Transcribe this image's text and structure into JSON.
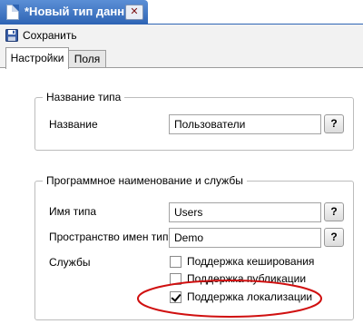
{
  "document_tab": {
    "title": "*Новый тип данны",
    "close_glyph": "✕"
  },
  "toolbar": {
    "save_label": "Сохранить"
  },
  "tabs": [
    {
      "label": "Настройки",
      "active": true
    },
    {
      "label": "Поля",
      "active": false
    }
  ],
  "type_name_group": {
    "title": "Название типа",
    "name_label": "Название",
    "name_value": "Пользователи",
    "help_label": "?"
  },
  "programmatic_group": {
    "title": "Программное наименование и службы",
    "type_name_label": "Имя типа",
    "type_name_value": "Users",
    "namespace_label": "Пространство имен типа",
    "namespace_value": "Demo",
    "services_label": "Службы",
    "help_label": "?",
    "services": [
      {
        "label": "Поддержка кеширования",
        "checked": false
      },
      {
        "label": "Поддержка публикации",
        "checked": false
      },
      {
        "label": "Поддержка локализации",
        "checked": true
      }
    ]
  },
  "colors": {
    "tab_blue": "#2e64b4",
    "annotation_red": "#d01010"
  }
}
